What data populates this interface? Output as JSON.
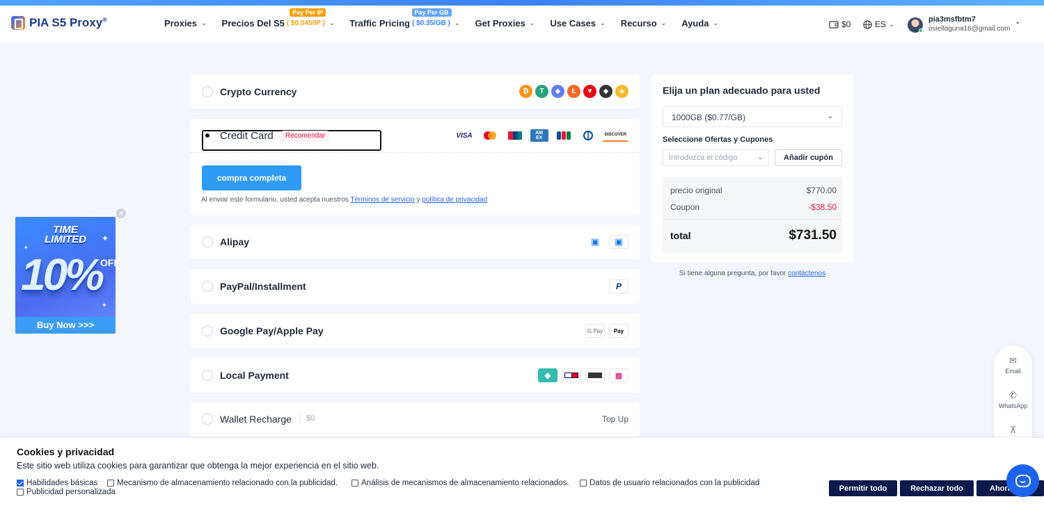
{
  "header": {
    "logo": "PIA S5 Proxy",
    "logo_reg": "®",
    "nav": [
      {
        "label": "Proxies"
      },
      {
        "label": "Precios Del S5",
        "highlight": "( $0.045/IP )",
        "badge": "Pay Per IP"
      },
      {
        "label": "Traffic Pricing",
        "highlight": "( $0.35/GB )",
        "badge": "Pay Per GB"
      },
      {
        "label": "Get Proxies"
      },
      {
        "label": "Use Cases"
      },
      {
        "label": "Recurso"
      },
      {
        "label": "Ayuda"
      }
    ],
    "balance": "$0",
    "language": "ES",
    "user_name": "pia3msfbtm7",
    "user_email": "osiellaguna16@gmail.com"
  },
  "payment_methods": {
    "crypto": {
      "label": "Crypto Currency"
    },
    "credit": {
      "label": "Credit Card",
      "recommend": "Recomendar",
      "cards": [
        "VISA",
        "MC",
        "UnionPay",
        "AMEX",
        "JCB",
        "Diners",
        "DISCOVER"
      ],
      "button": "compra completa",
      "terms_prefix": "Al enviar este formulario, usted acepta nuestros",
      "terms_link": "Términos de servicio",
      "terms_and": "y",
      "privacy_link": "política de privacidad"
    },
    "alipay": {
      "label": "Alipay"
    },
    "paypal": {
      "label": "PayPal/Installment"
    },
    "google": {
      "label": "Google Pay/Apple Pay",
      "g": "G Pay",
      "a": "Pay"
    },
    "local": {
      "label": "Local Payment"
    },
    "wallet": {
      "label": "Wallet Recharge",
      "balance": "$0",
      "topup": "Top Up"
    }
  },
  "plan": {
    "title": "Elija un plan adecuado para usted",
    "selected": "1000GB ($0.77/GB)",
    "offers_label": "Seleccione Ofertas y Cupones",
    "coupon_placeholder": "Introduzca el código",
    "add_coupon": "Añadir cupón",
    "original_label": "precio original",
    "original_value": "$770.00",
    "coupon_label": "Coupon",
    "coupon_value": "-$38.50",
    "total_label": "total",
    "total_value": "$731.50",
    "help_text": "Si tiene alguna pregunta, por favor",
    "help_link": "contáctenos"
  },
  "promo": {
    "line1": "TIME",
    "line2": "LIMITED",
    "big": "10%",
    "off": "OFF",
    "buy": "Buy Now >>>"
  },
  "side_tools": {
    "email": "Email",
    "whatsapp": "WhatsApp"
  },
  "cookies": {
    "title": "Cookies y privacidad",
    "description": "Este sitio web utiliza cookies para garantizar que obtenga la mejor experiencia en el sitio web.",
    "options": [
      {
        "label": "Habilidades básicas",
        "checked": true
      },
      {
        "label": "Mecanismo de almacenamiento relacionado con la publicidad.",
        "checked": false
      },
      {
        "label": "Análisis de mecanismos de almacenamiento relacionados.",
        "checked": false
      },
      {
        "label": "Datos de usuario relacionados con la publicidad",
        "checked": false
      },
      {
        "label": "Publicidad personalizada",
        "checked": false
      }
    ],
    "allow_all": "Permitir todo",
    "reject_all": "Rechazar todo",
    "now": "Ahora"
  }
}
